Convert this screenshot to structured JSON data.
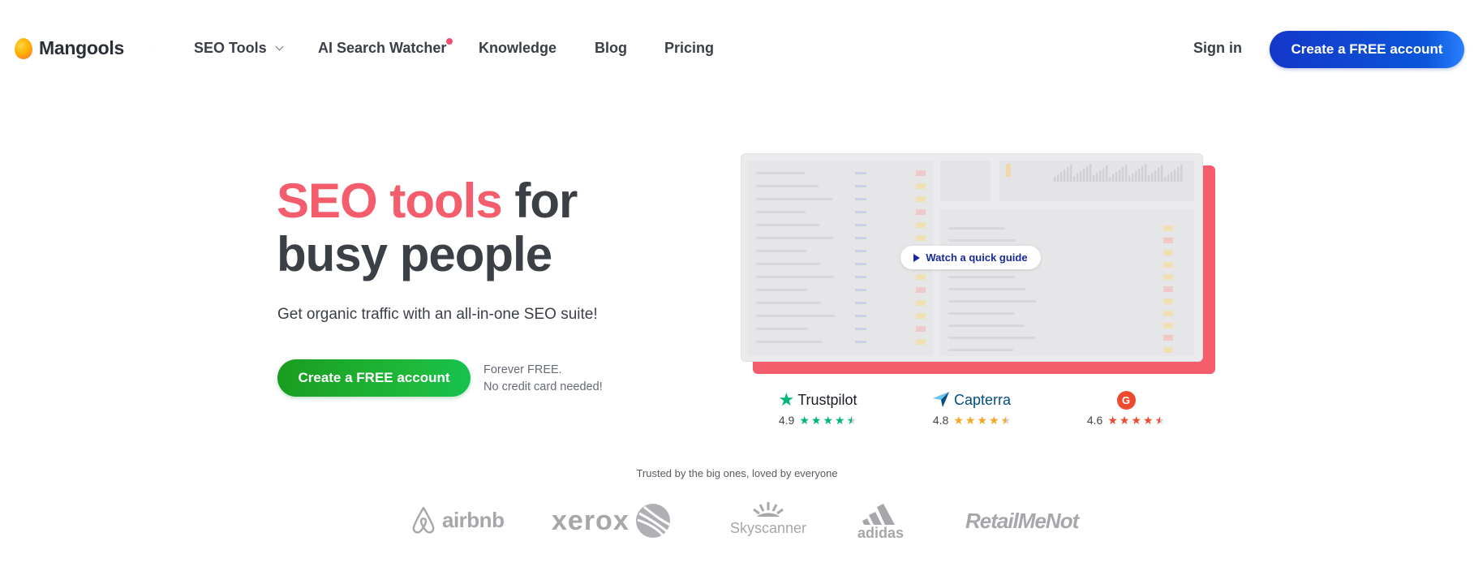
{
  "brand": {
    "name": "Mangools"
  },
  "nav": {
    "items": [
      {
        "label": "SEO Tools",
        "has_dropdown": true
      },
      {
        "label": "AI Search Watcher",
        "has_dot": true
      },
      {
        "label": "Knowledge"
      },
      {
        "label": "Blog"
      },
      {
        "label": "Pricing"
      }
    ],
    "signin": "Sign in",
    "cta": "Create a FREE account"
  },
  "hero": {
    "title_accent": "SEO tools",
    "title_rest_1": " for",
    "title_line2": "busy people",
    "subtitle": "Get organic traffic with an all-in-one SEO suite!",
    "cta": "Create a FREE account",
    "note_line1": "Forever FREE.",
    "note_line2": "No credit card needed!",
    "video_button": "Watch a quick guide"
  },
  "ratings": [
    {
      "name": "Trustpilot",
      "score": "4.9",
      "stars": 4.5,
      "color": "#00b67a"
    },
    {
      "name": "Capterra",
      "score": "4.8",
      "stars": 4.5,
      "color": "#f5a623"
    },
    {
      "name": "G2",
      "score": "4.6",
      "stars": 4.5,
      "color": "#ef4a2f"
    }
  ],
  "trusted": {
    "text": "Trusted by the big ones, loved by everyone",
    "logos": [
      "airbnb",
      "xerox",
      "Skyscanner",
      "adidas",
      "RetailMeNot"
    ]
  },
  "colors": {
    "accent_red": "#f45d6b",
    "primary_blue": "#1437c9",
    "green": "#1fb93a"
  }
}
